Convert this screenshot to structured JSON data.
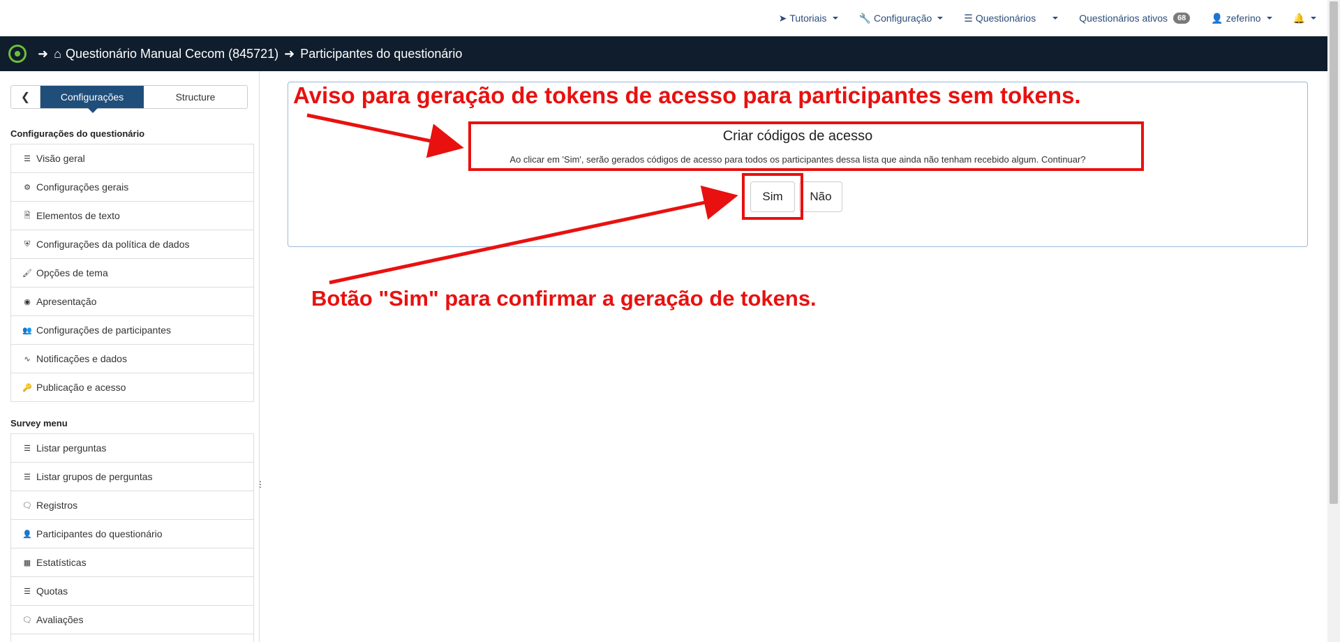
{
  "topnav": {
    "tutoriais": "Tutoriais",
    "configuracao": "Configuração",
    "questionarios": "Questionários",
    "questionarios_ativos": "Questionários ativos",
    "questionarios_ativos_count": "68",
    "user": "zeferino"
  },
  "breadcrumb": {
    "survey": "Questionário Manual Cecom (845721)",
    "page": "Participantes do questionário"
  },
  "sidebar": {
    "tab_active": "Configurações",
    "tab_inactive": "Structure",
    "section1_title": "Configurações do questionário",
    "section1_items": [
      {
        "label": "Visão geral",
        "icon": "list-icon"
      },
      {
        "label": "Configurações gerais",
        "icon": "gears-icon"
      },
      {
        "label": "Elementos de texto",
        "icon": "file-text-icon"
      },
      {
        "label": "Configurações da política de dados",
        "icon": "shield-icon"
      },
      {
        "label": "Opções de tema",
        "icon": "brush-icon"
      },
      {
        "label": "Apresentação",
        "icon": "eye-slash-icon"
      },
      {
        "label": "Configurações de participantes",
        "icon": "users-icon"
      },
      {
        "label": "Notificações e dados",
        "icon": "rss-icon"
      },
      {
        "label": "Publicação e acesso",
        "icon": "key-icon"
      }
    ],
    "section2_title": "Survey menu",
    "section2_items": [
      {
        "label": "Listar perguntas",
        "icon": "list-icon"
      },
      {
        "label": "Listar grupos de perguntas",
        "icon": "th-list-icon"
      },
      {
        "label": "Registros",
        "icon": "comment-icon"
      },
      {
        "label": "Participantes do questionário",
        "icon": "user-icon"
      },
      {
        "label": "Estatísticas",
        "icon": "bar-chart-icon"
      },
      {
        "label": "Quotas",
        "icon": "tasks-icon"
      },
      {
        "label": "Avaliações",
        "icon": "comment-icon"
      }
    ]
  },
  "modal": {
    "title": "Criar códigos de acesso",
    "text": "Ao clicar em 'Sim', serão gerados códigos de acesso para todos os participantes dessa lista que ainda não tenham recebido algum. Continuar?",
    "yes": "Sim",
    "no": "Não"
  },
  "annotations": {
    "top": "Aviso para geração de tokens de acesso para participantes sem tokens.",
    "bottom": "Botão \"Sim\" para confirmar a geração de tokens.",
    "color": "#e8110f"
  },
  "colors": {
    "navy": "#0f1d2c",
    "accent": "#1f4e7a",
    "link": "#2a4d7a"
  }
}
